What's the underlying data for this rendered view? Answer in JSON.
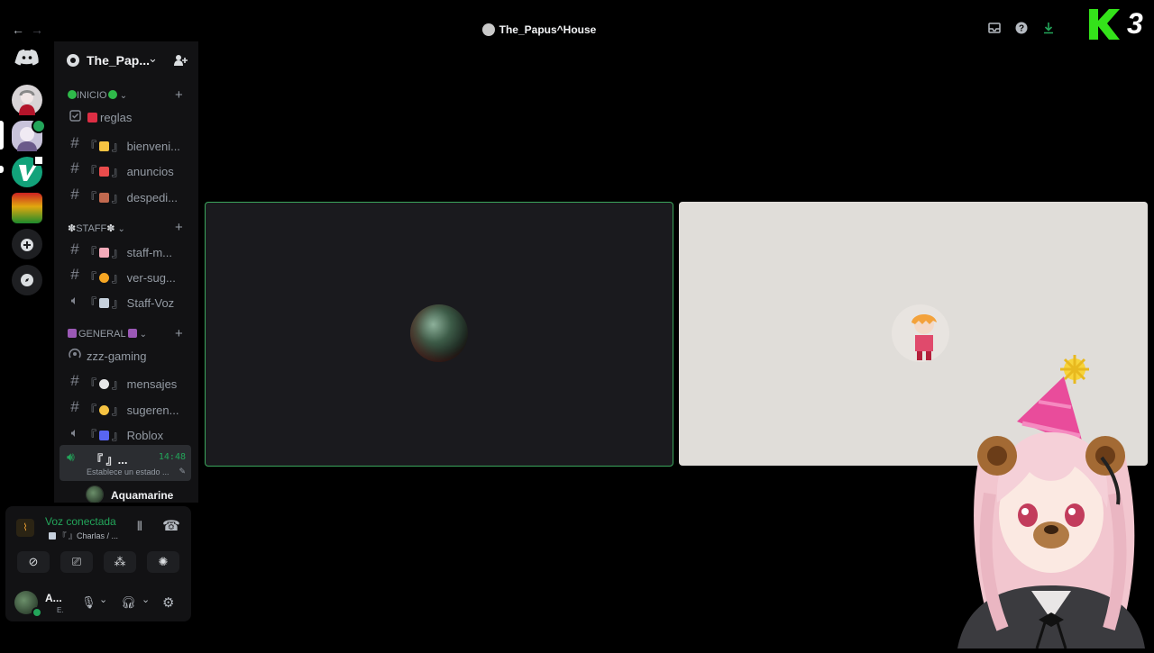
{
  "titlebar": {
    "title": "The_Papus^House",
    "back_icon": "arrow-left-icon",
    "forward_icon": "arrow-right-icon",
    "right_icons": [
      "inbox-icon",
      "help-icon",
      "download-icon"
    ]
  },
  "watermark": {
    "text": "3"
  },
  "servers": {
    "items": [
      "discord-home",
      "server-maid",
      "server-active",
      "server-v",
      "server-flag",
      "add-server",
      "explore"
    ]
  },
  "guild": {
    "name": "The_Pap...",
    "invite_icon": "add-member-icon"
  },
  "categories": [
    {
      "label": "INICIO"
    },
    {
      "label": "STAFF"
    },
    {
      "label": "GENERAL"
    }
  ],
  "channels": {
    "inicio": [
      {
        "name": "reglas",
        "type": "rules"
      },
      {
        "name": "bienveni...",
        "type": "text",
        "prefix": "『",
        "suffix": "』"
      },
      {
        "name": "anuncios",
        "type": "text",
        "prefix": "『",
        "suffix": "』"
      },
      {
        "name": "despedi...",
        "type": "text",
        "prefix": "『",
        "suffix": "』"
      }
    ],
    "staff": [
      {
        "name": "staff-m...",
        "type": "text",
        "prefix": "『",
        "suffix": "』"
      },
      {
        "name": "ver-sug...",
        "type": "text",
        "prefix": "『",
        "suffix": "』"
      },
      {
        "name": "Staff-Voz",
        "type": "voice",
        "prefix": "『",
        "suffix": "』"
      }
    ],
    "general": [
      {
        "name": "zzz-gaming",
        "type": "stage"
      },
      {
        "name": "mensajes",
        "type": "text",
        "prefix": "『",
        "suffix": "』"
      },
      {
        "name": "sugeren...",
        "type": "text",
        "prefix": "『",
        "suffix": "』"
      },
      {
        "name": "Roblox",
        "type": "voice",
        "prefix": "『",
        "suffix": "』"
      }
    ]
  },
  "active_voice": {
    "name": "『 』...",
    "time": "14:48",
    "status": "Establece un estado ...",
    "member": "Aquamarine"
  },
  "voice_panel": {
    "status": "Voz conectada",
    "channel": "『 』Charlas / ...",
    "buttons": [
      "camera-off-icon",
      "screen-share-icon",
      "activities-icon",
      "soundboard-icon"
    ]
  },
  "user": {
    "name": "A...",
    "sub": "E."
  },
  "colors": {
    "accent_green": "#3ba55c",
    "voice_green": "#23a55a"
  }
}
